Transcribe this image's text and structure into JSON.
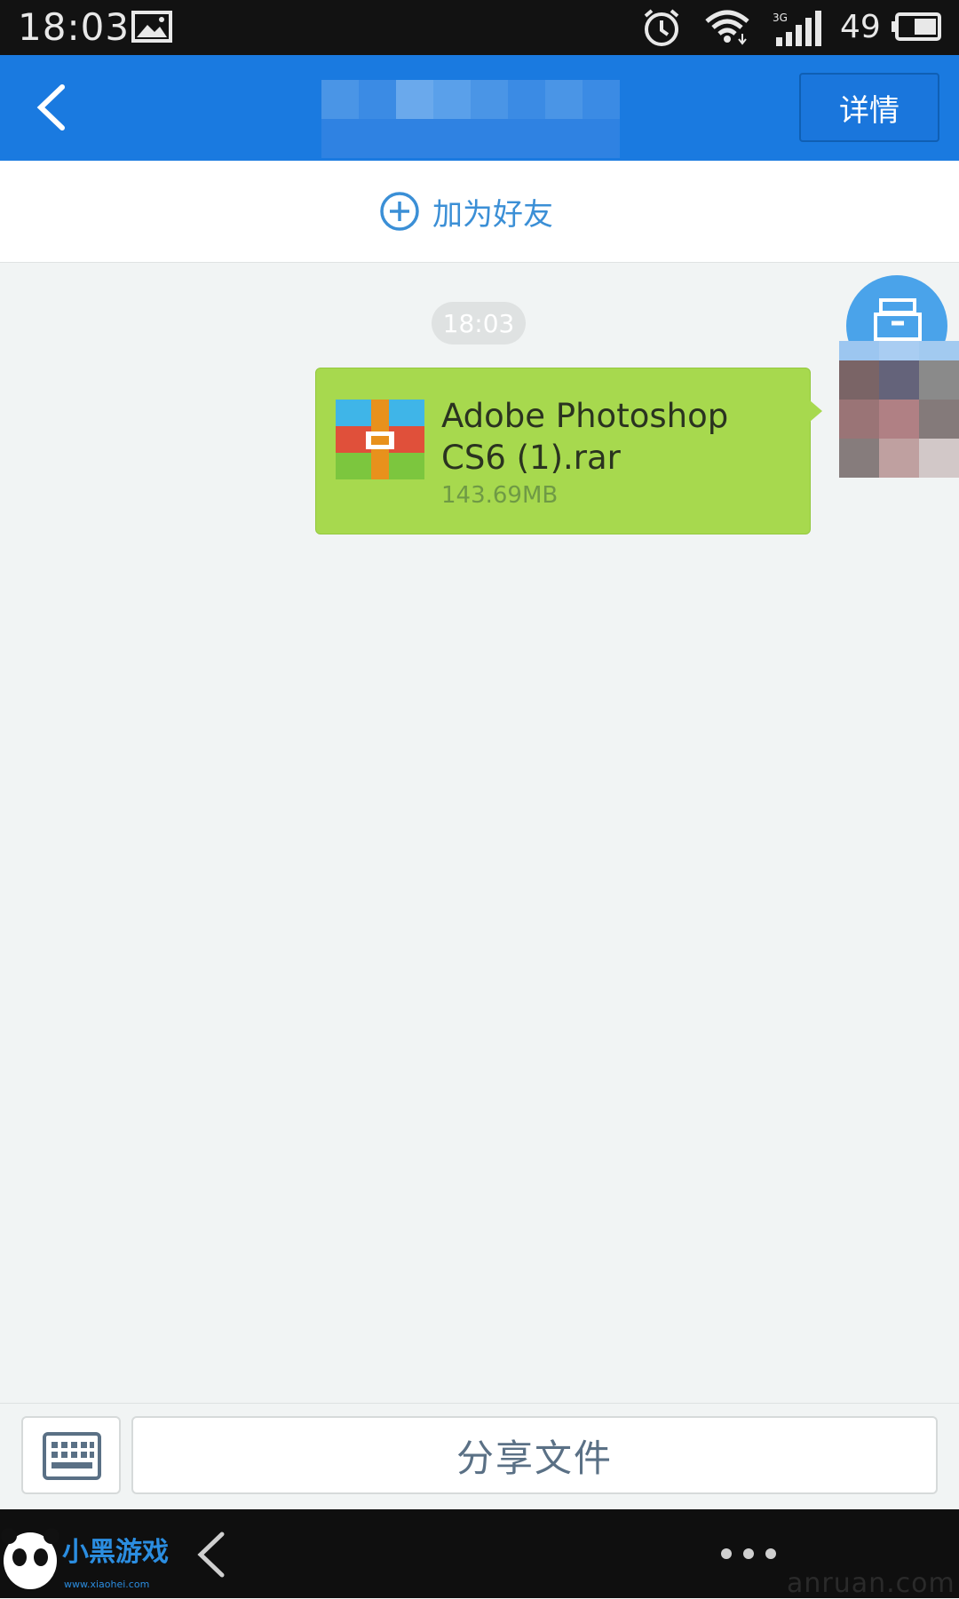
{
  "status_bar": {
    "time": "18:03",
    "network_label": "3G",
    "battery_level": "49",
    "icons": [
      "image-icon",
      "alarm-icon",
      "wifi-icon",
      "signal-icon",
      "battery-icon"
    ]
  },
  "header": {
    "back_icon": "chevron-left-icon",
    "details_label": "详情"
  },
  "add_friend": {
    "icon": "plus-circle-icon",
    "label": "加为好友"
  },
  "chat": {
    "timestamp": "18:03",
    "message": {
      "file_icon": "rar-archive-icon",
      "file_name": "Adobe Photoshop CS6 (1).rar",
      "file_size": "143.69MB"
    },
    "avatar_badge_icon": "inbox-icon"
  },
  "input_bar": {
    "keyboard_icon": "keyboard-icon",
    "share_label": "分享文件"
  },
  "nav_bar": {
    "back_icon": "back-icon",
    "more_icon": "more-dots-icon",
    "logo_text": "小黑游戏",
    "logo_url_text": "www.xiaohei.com"
  },
  "watermark": "anruan.com",
  "colors": {
    "app_bar": "#1a7ae0",
    "bubble": "#a7d94e",
    "link": "#3b8fd6",
    "background": "#f1f4f4"
  }
}
